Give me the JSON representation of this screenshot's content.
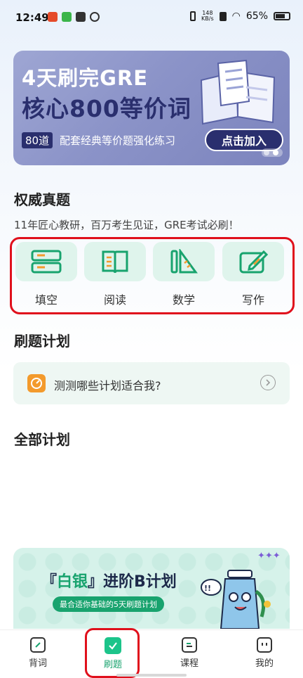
{
  "status_bar": {
    "time": "12:49",
    "net_speed_value": "148",
    "net_speed_unit": "KB/s",
    "battery": "65%"
  },
  "banner": {
    "line1": "4天刷完GRE",
    "line2": "核心800等价词",
    "tag": "80道",
    "subtitle": "配套经典等价题强化练习",
    "button": "点击加入"
  },
  "authority": {
    "title": "权威真题",
    "desc": "11年匠心教研，百万考生见证，GRE考试必刷！",
    "items": [
      {
        "label": "填空",
        "icon": "fill-blank-icon"
      },
      {
        "label": "阅读",
        "icon": "reading-book-icon"
      },
      {
        "label": "数学",
        "icon": "math-ruler-icon"
      },
      {
        "label": "写作",
        "icon": "writing-pencil-icon"
      }
    ]
  },
  "plan": {
    "title": "刷题计划",
    "card_text": "测测哪些计划适合我?"
  },
  "all_plans": {
    "title": "全部计划"
  },
  "promo": {
    "title_left": "『",
    "title_hl": "白银",
    "title_right": "』进阶B计划",
    "subtitle": "最合适你基础的5天刷题计划"
  },
  "bottom_nav": {
    "items": [
      {
        "label": "背词",
        "icon": "vocab-icon"
      },
      {
        "label": "刷题",
        "icon": "practice-check-icon"
      },
      {
        "label": "课程",
        "icon": "course-icon"
      },
      {
        "label": "我的",
        "icon": "profile-icon"
      }
    ],
    "active": "刷题"
  },
  "colors": {
    "accent_green": "#18a36e",
    "highlight_red": "#e0101c",
    "banner_navy": "#2a2f6e"
  }
}
